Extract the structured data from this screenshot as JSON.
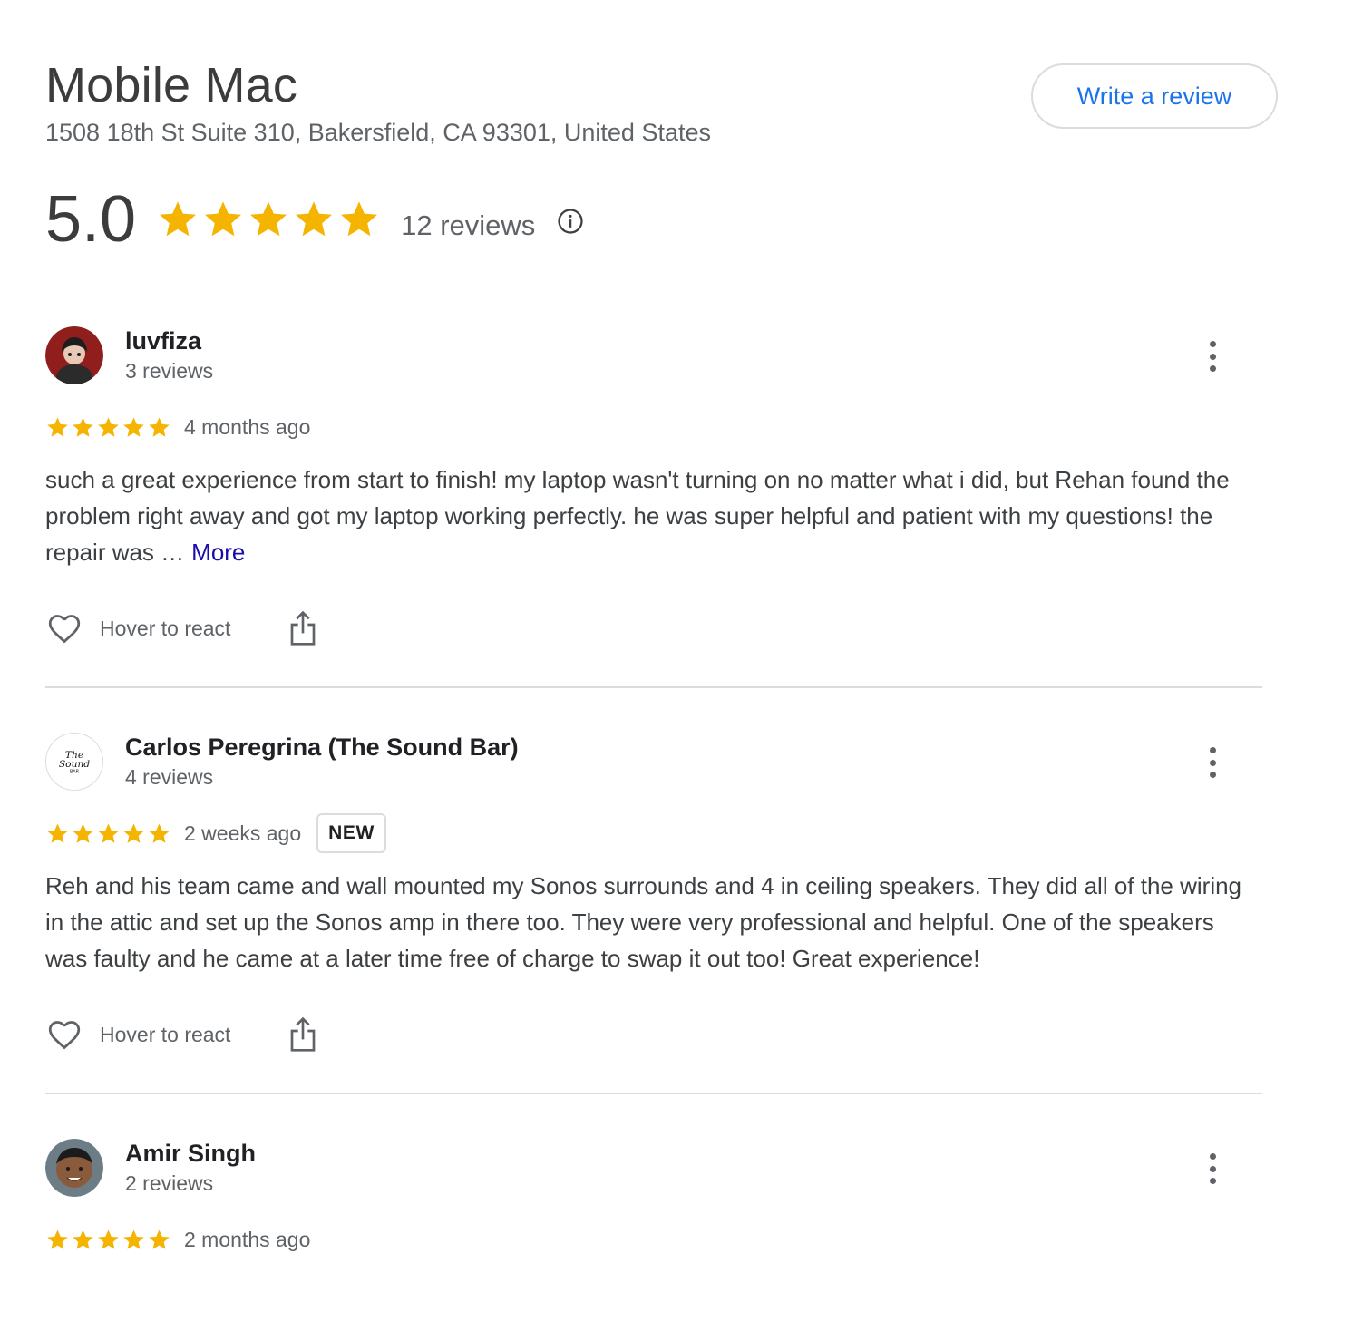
{
  "business": {
    "name": "Mobile Mac",
    "address": "1508 18th St Suite 310, Bakersfield, CA 93301, United States",
    "write_review_label": "Write a review",
    "rating": "5.0",
    "star_count": 5,
    "reviews_label": "12 reviews"
  },
  "colors": {
    "star": "#f4b400",
    "link": "#1a73e8",
    "more": "#1a0dab",
    "divider": "#dadce0"
  },
  "reviews": [
    {
      "name": "luvfiza",
      "count": "3 reviews",
      "rating": 5,
      "time": "4 months ago",
      "text": "such a great experience from start to finish! my laptop wasn't turning on no matter what i did, but Rehan found the problem right away and got my laptop working perfectly. he was super helpful and patient with my questions! the repair was …",
      "more_label": "More",
      "react_label": "Hover to react"
    },
    {
      "name": "Carlos Peregrina (The Sound Bar)",
      "count": "4 reviews",
      "rating": 5,
      "time": "2 weeks ago",
      "badge": "NEW",
      "text": "Reh and his team came and wall mounted my Sonos surrounds and 4 in ceiling speakers. They did all of the wiring in the attic and set up the Sonos amp in there too. They were very professional and helpful. One of the speakers was faulty and he came at a later time free of charge to swap it out too! Great experience!",
      "react_label": "Hover to react",
      "avatar_logo_text": "The Sound Bar"
    },
    {
      "name": "Amir Singh",
      "count": "2 reviews",
      "rating": 5,
      "time": "2 months ago"
    }
  ]
}
